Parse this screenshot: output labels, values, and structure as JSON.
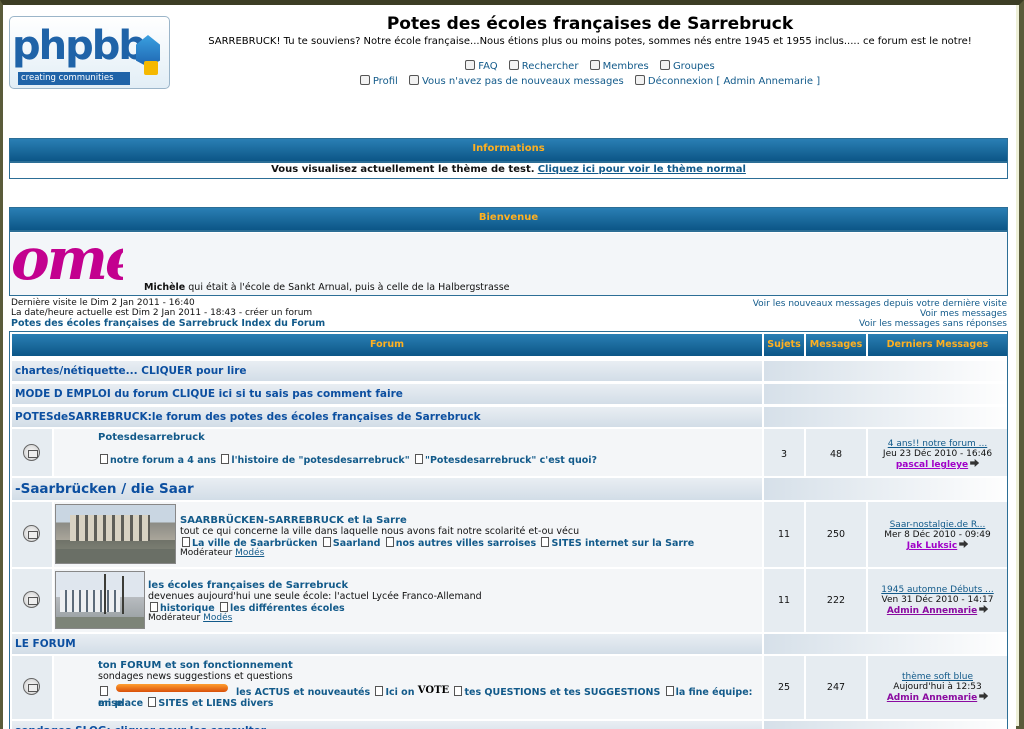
{
  "header": {
    "logo_word": "phpbb",
    "logo_tagline": "creating communities",
    "title": "Potes des écoles françaises de Sarrebruck",
    "description": "SARREBRUCK! Tu te souviens? Notre école française...Nous étions plus ou moins potes, sommes nés entre 1945 et 1955 inclus..... ce forum est le notre!",
    "nav1": [
      "FAQ",
      "Rechercher",
      "Membres",
      "Groupes"
    ],
    "nav2": {
      "profile": "Profil",
      "messages": "Vous n'avez pas de nouveaux messages",
      "logout": "Déconnexion [ Admin Annemarie ]"
    }
  },
  "info": {
    "title": "Informations",
    "text": "Vous visualisez actuellement le thème de test.",
    "link": "Cliquez ici pour voir le thème normal"
  },
  "welcome": {
    "title": "Bienvenue",
    "banner_text": "ome",
    "name": "Michèle",
    "text": " qui était à l'école de Sankt Arnual, puis à celle de la Halbergstrasse"
  },
  "status": {
    "last_visit": "Dernière visite le Dim 2 Jan 2011 - 16:40",
    "current": "La date/heure actuelle est Dim 2 Jan 2011 - 18:43 - créer un forum",
    "index_link": "Potes des écoles françaises de Sarrebruck Index du Forum",
    "right": [
      "Voir les nouveaux messages depuis votre dernière visite",
      "Voir mes messages",
      "Voir les messages sans réponses"
    ]
  },
  "table": {
    "headers": {
      "forum": "Forum",
      "topics": "Sujets",
      "posts": "Messages",
      "last": "Derniers Messages"
    },
    "categories": {
      "c1": "chartes/nétiquette... CLIQUER pour lire",
      "c2": "MODE D EMPLOI du forum CLIQUE ici si tu sais pas comment faire",
      "c3": "POTESdeSARREBRUCK:le forum des potes des écoles françaises de Sarrebruck",
      "c4": "-Saarbrücken / die Saar",
      "c5": "LE FORUM",
      "c6": "sondages SLOG: cliquer pour les consulter"
    },
    "forums": [
      {
        "title": "Potesdesarrebruck",
        "subs": [
          "notre forum a 4 ans",
          "l'histoire de \"potesdesarrebruck\"",
          "\"Potesdesarrebruck\" c'est quoi?"
        ],
        "topics": "3",
        "posts": "48",
        "last_title": "4 ans!! notre forum ...",
        "last_date": "Jeu 23 Déc 2010 - 16:46",
        "last_user": "pascal legleye"
      },
      {
        "title": "SAARBRÜCKEN-SARREBRUCK et la Sarre",
        "desc": "tout ce qui concerne la ville dans laquelle nous avons fait notre scolarité et-ou vécu",
        "subs": [
          "La ville de Saarbrücken",
          "Saarland",
          "nos autres villes sarroises",
          "SITES internet sur la Sarre"
        ],
        "mod_label": "Modérateur",
        "mod_link": "Modés",
        "topics": "11",
        "posts": "250",
        "last_title": "Saar-nostalgie.de R...",
        "last_date": "Mer 8 Déc 2010 - 09:49",
        "last_user": "Jak Luksic"
      },
      {
        "title": "les écoles françaises de Sarrebruck",
        "desc": "devenues aujourd'hui une seule école: l'actuel Lycée Franco-Allemand",
        "subs": [
          "historique",
          "les différentes écoles"
        ],
        "mod_label": "Modérateur",
        "mod_link": "Modés",
        "topics": "11",
        "posts": "222",
        "last_title": "1945 automne Débuts ...",
        "last_date": "Ven 31 Déc 2010 - 14:17",
        "last_user": "Admin Annemarie"
      },
      {
        "title": "ton FORUM et son fonctionnement",
        "desc": "sondages news suggestions et questions",
        "subs_line1": [
          "les ACTUS et nouveautés",
          "Ici on",
          "tes QUESTIONS et tes SUGGESTIONS",
          "la fine équipe: mise"
        ],
        "subs_line2_prefix": "en place",
        "subs_line2": [
          "SITES et LIENS divers"
        ],
        "vote_label": "VOTE",
        "topics": "25",
        "posts": "247",
        "last_title": "thème soft blue",
        "last_date": "Aujourd'hui à 12:53",
        "last_user": "Admin Annemarie"
      }
    ]
  },
  "colors": {
    "bar_top": "#2a7fb4",
    "bar_bottom": "#0c5687",
    "bar_text": "#ffb020",
    "link": "#125a8a",
    "category_text": "#0c4fa0",
    "frame": "#5a5b3a"
  }
}
